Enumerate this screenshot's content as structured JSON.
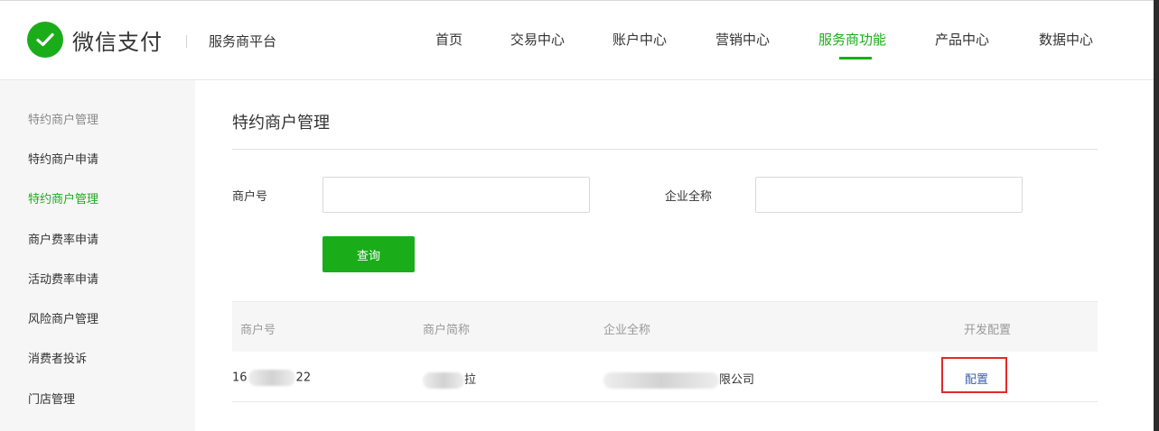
{
  "header": {
    "logo_text": "微信支付",
    "platform": "服务商平台",
    "nav": [
      {
        "label": "首页",
        "active": false
      },
      {
        "label": "交易中心",
        "active": false
      },
      {
        "label": "账户中心",
        "active": false
      },
      {
        "label": "营销中心",
        "active": false
      },
      {
        "label": "服务商功能",
        "active": true
      },
      {
        "label": "产品中心",
        "active": false
      },
      {
        "label": "数据中心",
        "active": false
      }
    ]
  },
  "sidebar": {
    "group_label": "特约商户管理",
    "items": [
      {
        "label": "特约商户申请",
        "active": false
      },
      {
        "label": "特约商户管理",
        "active": true
      },
      {
        "label": "商户费率申请",
        "active": false
      },
      {
        "label": "活动费率申请",
        "active": false
      },
      {
        "label": "风险商户管理",
        "active": false
      },
      {
        "label": "消费者投诉",
        "active": false
      },
      {
        "label": "门店管理",
        "active": false
      }
    ]
  },
  "main": {
    "title": "特约商户管理",
    "form": {
      "merchant_id_label": "商户号",
      "merchant_id_value": "",
      "company_label": "企业全称",
      "company_value": "",
      "query_button": "查询"
    },
    "table": {
      "columns": [
        "商户号",
        "商户简称",
        "企业全称",
        "开发配置"
      ],
      "rows": [
        {
          "merchant_id_prefix": "16",
          "merchant_id_suffix": "22",
          "short_name_suffix": "拉",
          "company_suffix": "限公司",
          "action": "配置"
        }
      ]
    }
  },
  "colors": {
    "brand_green": "#1aad19",
    "link_blue": "#3b5dac",
    "highlight_red": "#e12b2b"
  },
  "icons": {
    "logo": "wechat-pay-check-icon"
  }
}
